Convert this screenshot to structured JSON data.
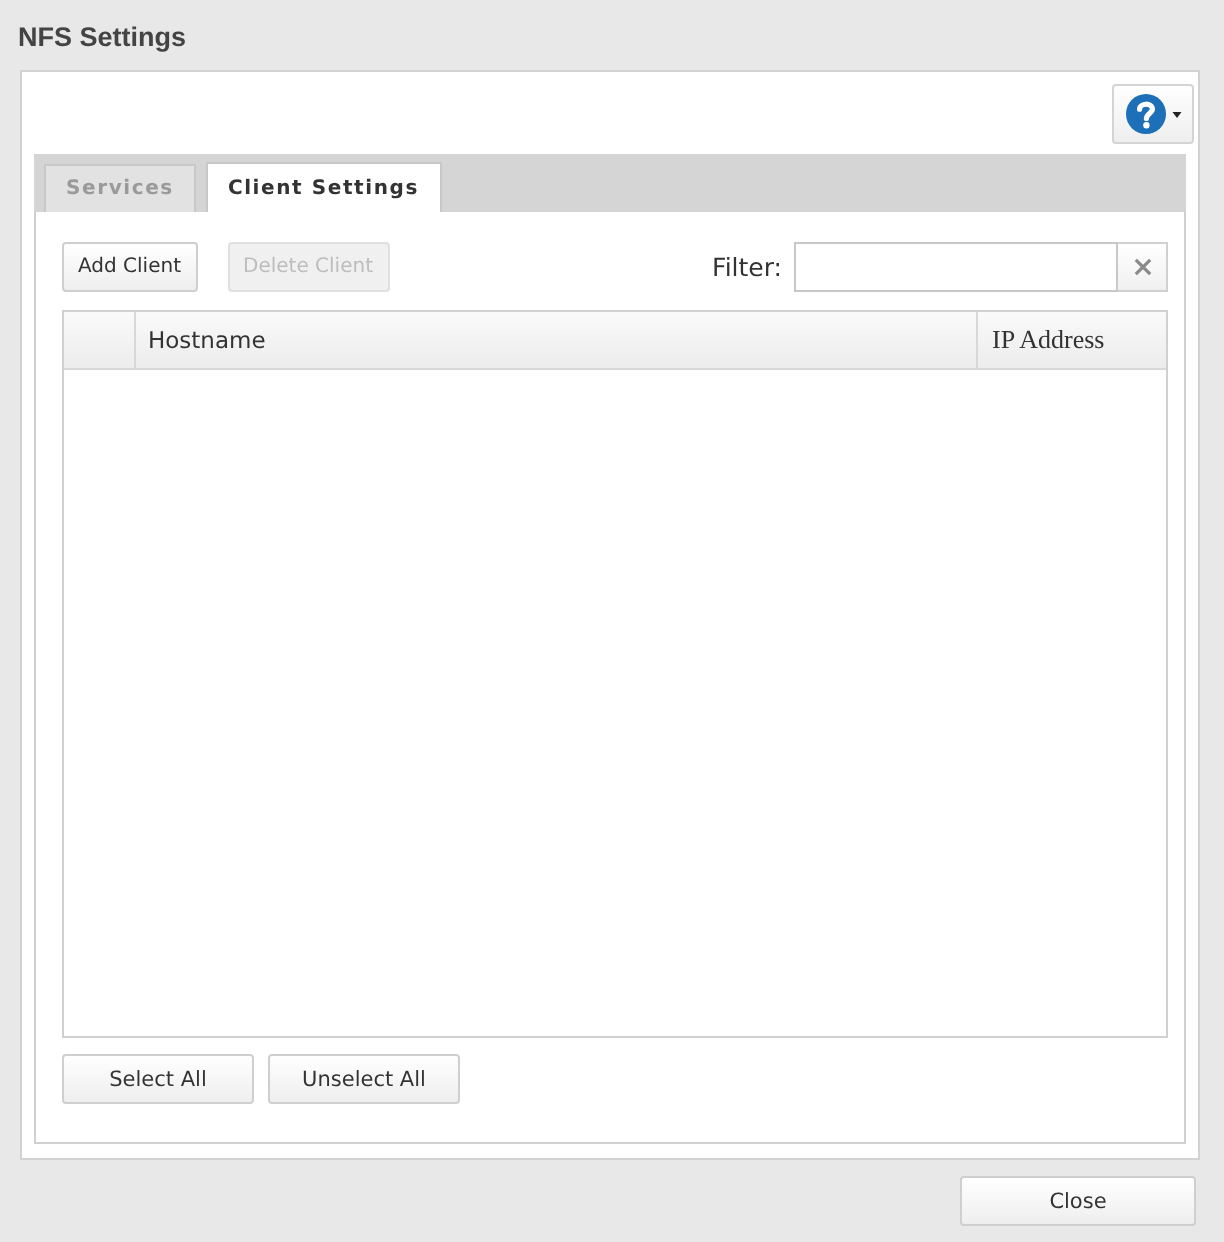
{
  "window": {
    "title": "NFS Settings"
  },
  "tabs": [
    {
      "label": "Services",
      "selected": false
    },
    {
      "label": "Client Settings",
      "selected": true
    }
  ],
  "toolbar": {
    "buttons": [
      {
        "label": "Add Client",
        "disabled": false
      },
      {
        "label": "Delete Client",
        "disabled": true
      }
    ],
    "filter": {
      "label": "Filter:"
    }
  },
  "table": {
    "columns": [
      "Hostname",
      "IP Address"
    ]
  },
  "selection_buttons": [
    "Select All",
    "Unselect All"
  ],
  "footer": {
    "buttons": [
      "Close"
    ]
  }
}
